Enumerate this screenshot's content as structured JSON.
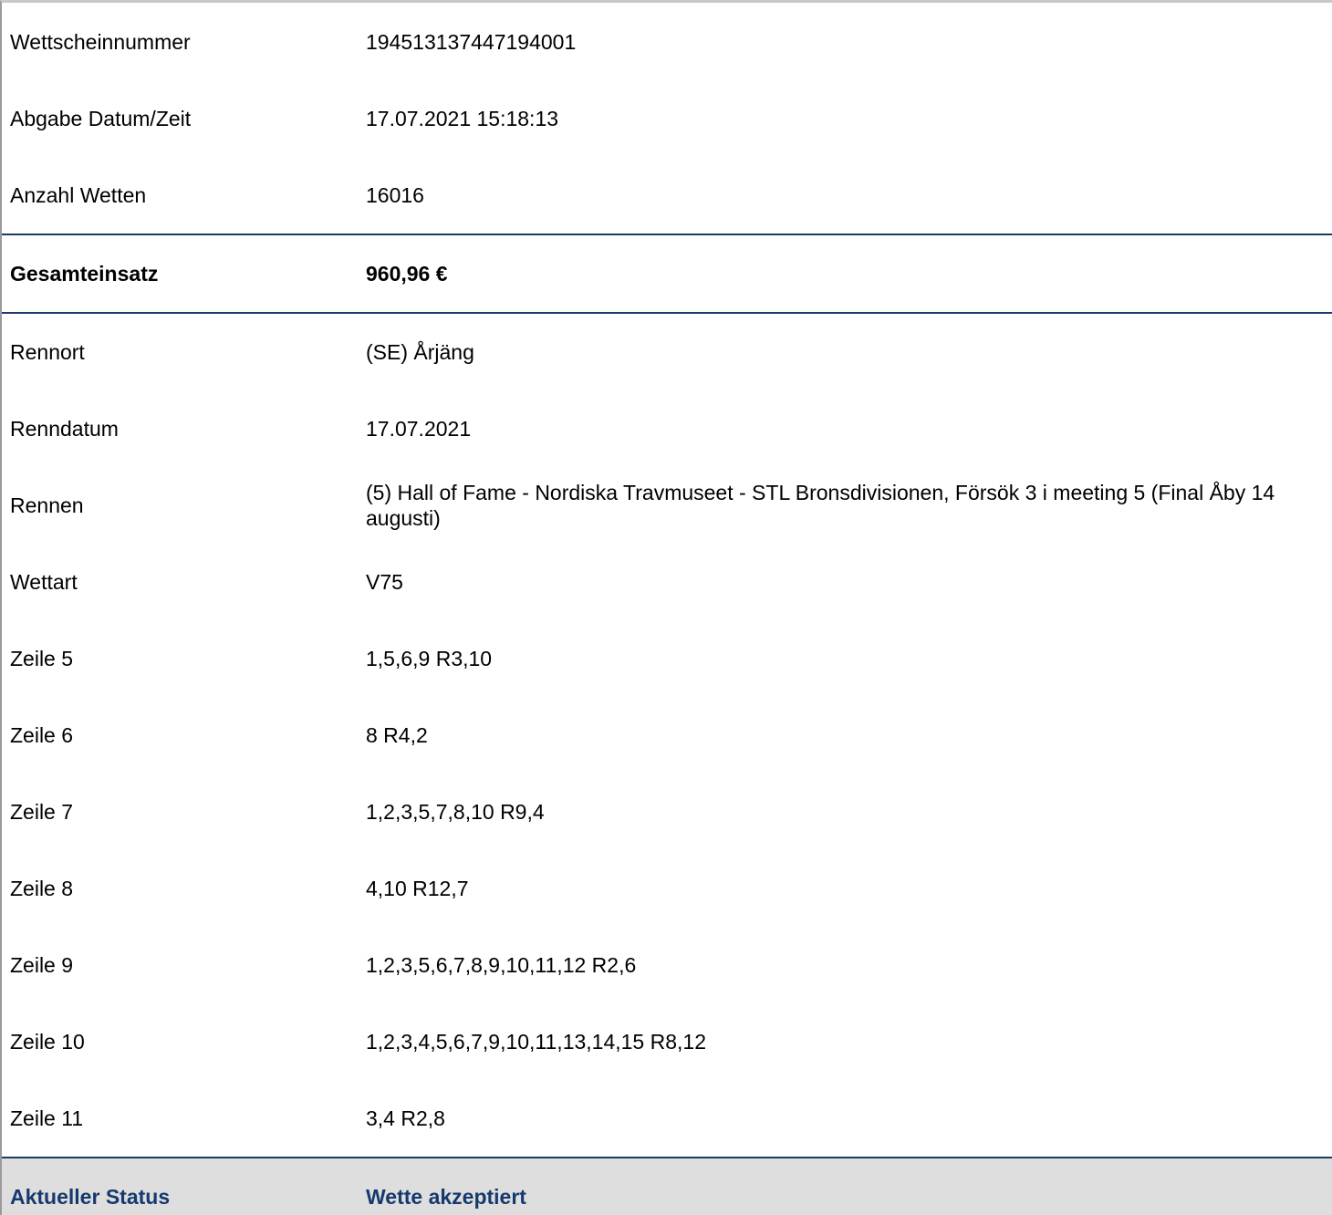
{
  "summary": {
    "ticket_number_label": "Wettscheinnummer",
    "ticket_number": "194513137447194001",
    "submitted_label": "Abgabe Datum/Zeit",
    "submitted": "17.07.2021 15:18:13",
    "bet_count_label": "Anzahl Wetten",
    "bet_count": "16016",
    "total_stake_label": "Gesamteinsatz",
    "total_stake": "960,96 €"
  },
  "race": {
    "venue_label": "Rennort",
    "venue": "(SE) Årjäng",
    "date_label": "Renndatum",
    "date": "17.07.2021",
    "race_label": "Rennen",
    "race": "(5) Hall of Fame - Nordiska Travmuseet - STL Bronsdivisionen, Försök 3 i meeting 5 (Final Åby 14 augusti)",
    "bet_type_label": "Wettart",
    "bet_type": "V75"
  },
  "lines": [
    {
      "label": "Zeile 5",
      "value": "1,5,6,9 R3,10"
    },
    {
      "label": "Zeile 6",
      "value": "8 R4,2"
    },
    {
      "label": "Zeile 7",
      "value": "1,2,3,5,7,8,10 R9,4"
    },
    {
      "label": "Zeile 8",
      "value": "4,10 R12,7"
    },
    {
      "label": "Zeile 9",
      "value": "1,2,3,5,6,7,8,9,10,11,12 R2,6"
    },
    {
      "label": "Zeile 10",
      "value": "1,2,3,4,5,6,7,9,10,11,13,14,15 R8,12"
    },
    {
      "label": "Zeile 11",
      "value": "3,4 R2,8"
    }
  ],
  "status": {
    "label": "Aktueller Status",
    "value": "Wette akzeptiert"
  },
  "colors": {
    "divider": "#1a3a6b",
    "status_text": "#163a6d",
    "status_background": "#dedede"
  }
}
